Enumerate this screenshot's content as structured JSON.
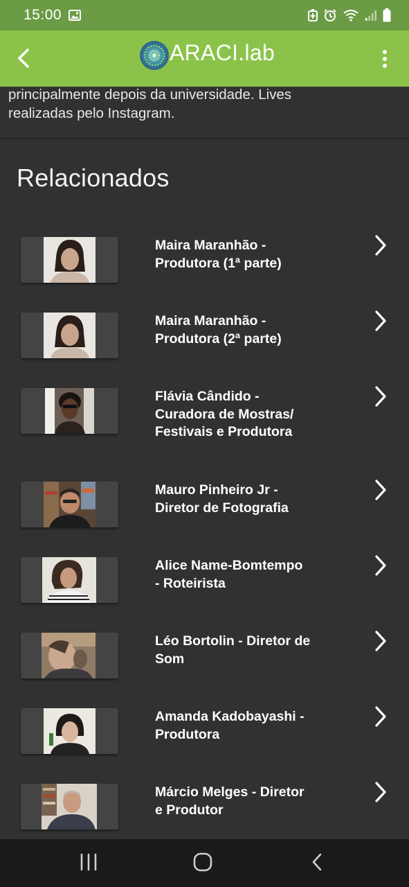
{
  "status_bar": {
    "time": "15:00"
  },
  "app_bar": {
    "title": "ARACI.lab"
  },
  "description": {
    "line1": "principalmente depois da universidade. Lives",
    "line2": "realizadas pelo Instagram."
  },
  "related": {
    "heading": "Relacionados",
    "items": [
      {
        "line1": "Maira Maranhão -",
        "line2": "Produtora (1ª parte)",
        "line3": ""
      },
      {
        "line1": "Maira Maranhão -",
        "line2": "Produtora (2ª parte)",
        "line3": ""
      },
      {
        "line1": "Flávia Cândido -",
        "line2": "Curadora de Mostras/",
        "line3": "Festivais  e Produtora"
      },
      {
        "line1": "Mauro Pinheiro Jr -",
        "line2": "Diretor de Fotografia",
        "line3": ""
      },
      {
        "line1": "Alice Name-Bomtempo",
        "line2": "- Roteirista",
        "line3": ""
      },
      {
        "line1": "Léo Bortolin - Diretor de",
        "line2": "Som",
        "line3": ""
      },
      {
        "line1": "Amanda Kadobayashi -",
        "line2": "Produtora",
        "line3": ""
      },
      {
        "line1": "Márcio Melges - Diretor",
        "line2": "e Produtor",
        "line3": ""
      }
    ]
  },
  "colors": {
    "status_bar": "#6c9b46",
    "app_bar": "#8bc34a",
    "background": "#313131",
    "nav_bar": "#1a1a1a"
  },
  "icons": {
    "back": "arrow-left-icon",
    "menu": "more-vertical-icon",
    "item_action": "chevron-right-icon",
    "nav": [
      "recent-apps-icon",
      "home-icon",
      "nav-back-icon"
    ]
  }
}
